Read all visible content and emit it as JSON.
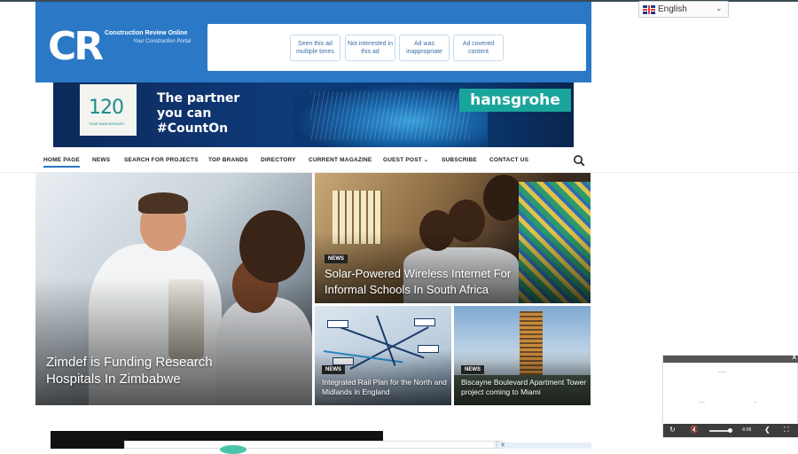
{
  "site": {
    "logo_text": "CR",
    "name": "Construction Review Online",
    "tagline": "Your Construction Portal"
  },
  "ad_feedback": {
    "buttons": [
      "Seen this ad multiple times",
      "Not interested in this ad",
      "Ad was inappropriate",
      "Ad covered content"
    ]
  },
  "banner": {
    "anniversary_number": "120",
    "anniversary_label": "YEAR ANNIVERSARY",
    "headline_line1": "The partner",
    "headline_line2": "you can",
    "headline_line3": "#CountOn",
    "brand": "hansgrohe"
  },
  "language": {
    "selected": "English"
  },
  "nav": {
    "items": [
      "HOME PAGE",
      "NEWS",
      "SEARCH FOR PROJECTS",
      "TOP BRANDS",
      "DIRECTORY",
      "CURRENT MAGAZINE",
      "GUEST POST",
      "SUBSCRIBE",
      "CONTACT US"
    ],
    "search_icon": "search-icon"
  },
  "articles": {
    "main": {
      "title": "Zimdef is Funding Research Hospitals In Zimbabwe"
    },
    "top_right": {
      "badge": "NEWS",
      "title": "Solar-Powered Wireless Internet For Informal Schools In South Africa"
    },
    "bottom_left": {
      "badge": "NEWS",
      "title": "Integrated Rail Plan for the North and Midlands in England"
    },
    "bottom_right": {
      "badge": "NEWS",
      "title": "Biscayne Boulevard Apartment Tower project coming to Miami"
    }
  },
  "video_player": {
    "close_label": "X",
    "time": "-0:06"
  },
  "colors": {
    "header_blue": "#2a78c6",
    "brand_teal": "#1aa59c",
    "badge_dark": "#222222"
  }
}
